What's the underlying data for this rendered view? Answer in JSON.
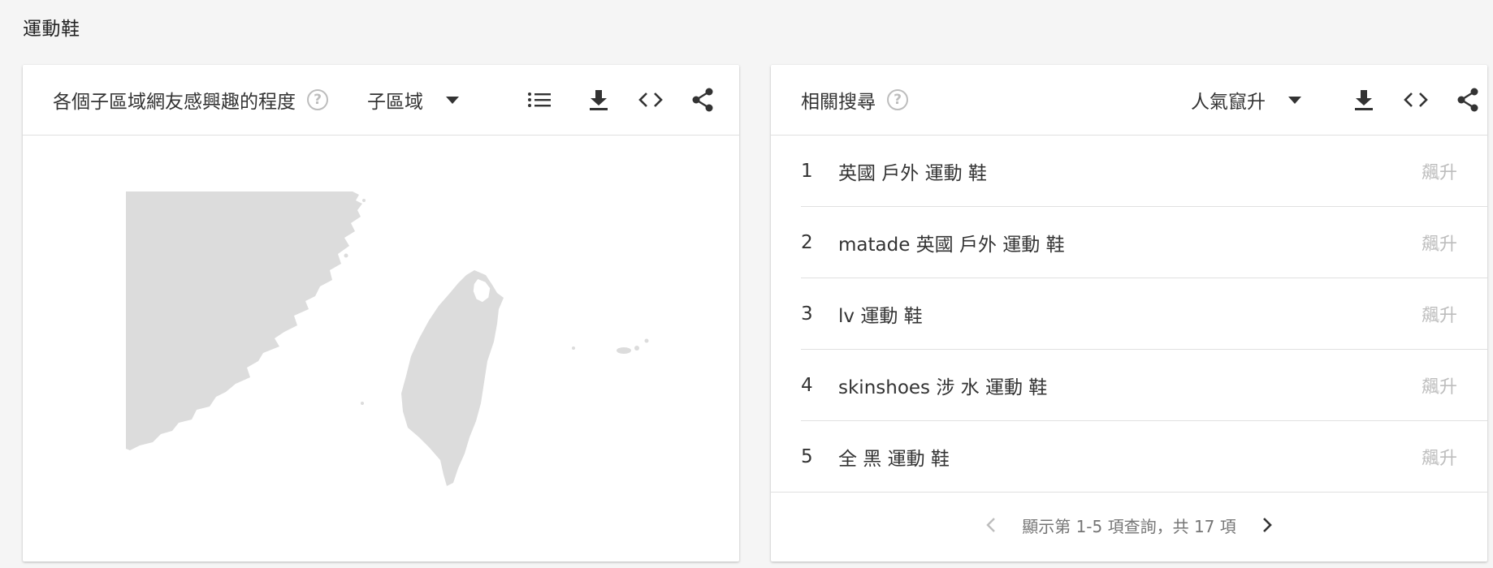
{
  "page": {
    "title": "運動鞋"
  },
  "region_card": {
    "title": "各個子區域網友感興趣的程度",
    "help_icon": "?",
    "resolution_select": {
      "selected": "子區域"
    },
    "icons": [
      "list-view-icon",
      "download-icon",
      "embed-icon",
      "share-icon"
    ],
    "map": {
      "fill_color": "#dcdcdc",
      "highlight_color": "#ffffff"
    }
  },
  "related_card": {
    "title": "相關搜尋",
    "help_icon": "?",
    "sort_select": {
      "selected": "人氣竄升"
    },
    "icons": [
      "download-icon",
      "embed-icon",
      "share-icon"
    ],
    "rows": [
      {
        "rank": "1",
        "query": "英國 戶外 運動 鞋",
        "value": "飆升"
      },
      {
        "rank": "2",
        "query": "matade 英國 戶外 運動 鞋",
        "value": "飆升"
      },
      {
        "rank": "3",
        "query": "lv 運動 鞋",
        "value": "飆升"
      },
      {
        "rank": "4",
        "query": "skinshoes 涉 水 運動 鞋",
        "value": "飆升"
      },
      {
        "rank": "5",
        "query": "全 黑 運動 鞋",
        "value": "飆升"
      }
    ],
    "pagination": {
      "text": "顯示第 1-5 項查詢，共 17 項"
    }
  },
  "colors": {
    "text": "#333333",
    "muted": "#bdbdbd",
    "divider": "#e0e0e0",
    "background": "#f5f5f5"
  }
}
